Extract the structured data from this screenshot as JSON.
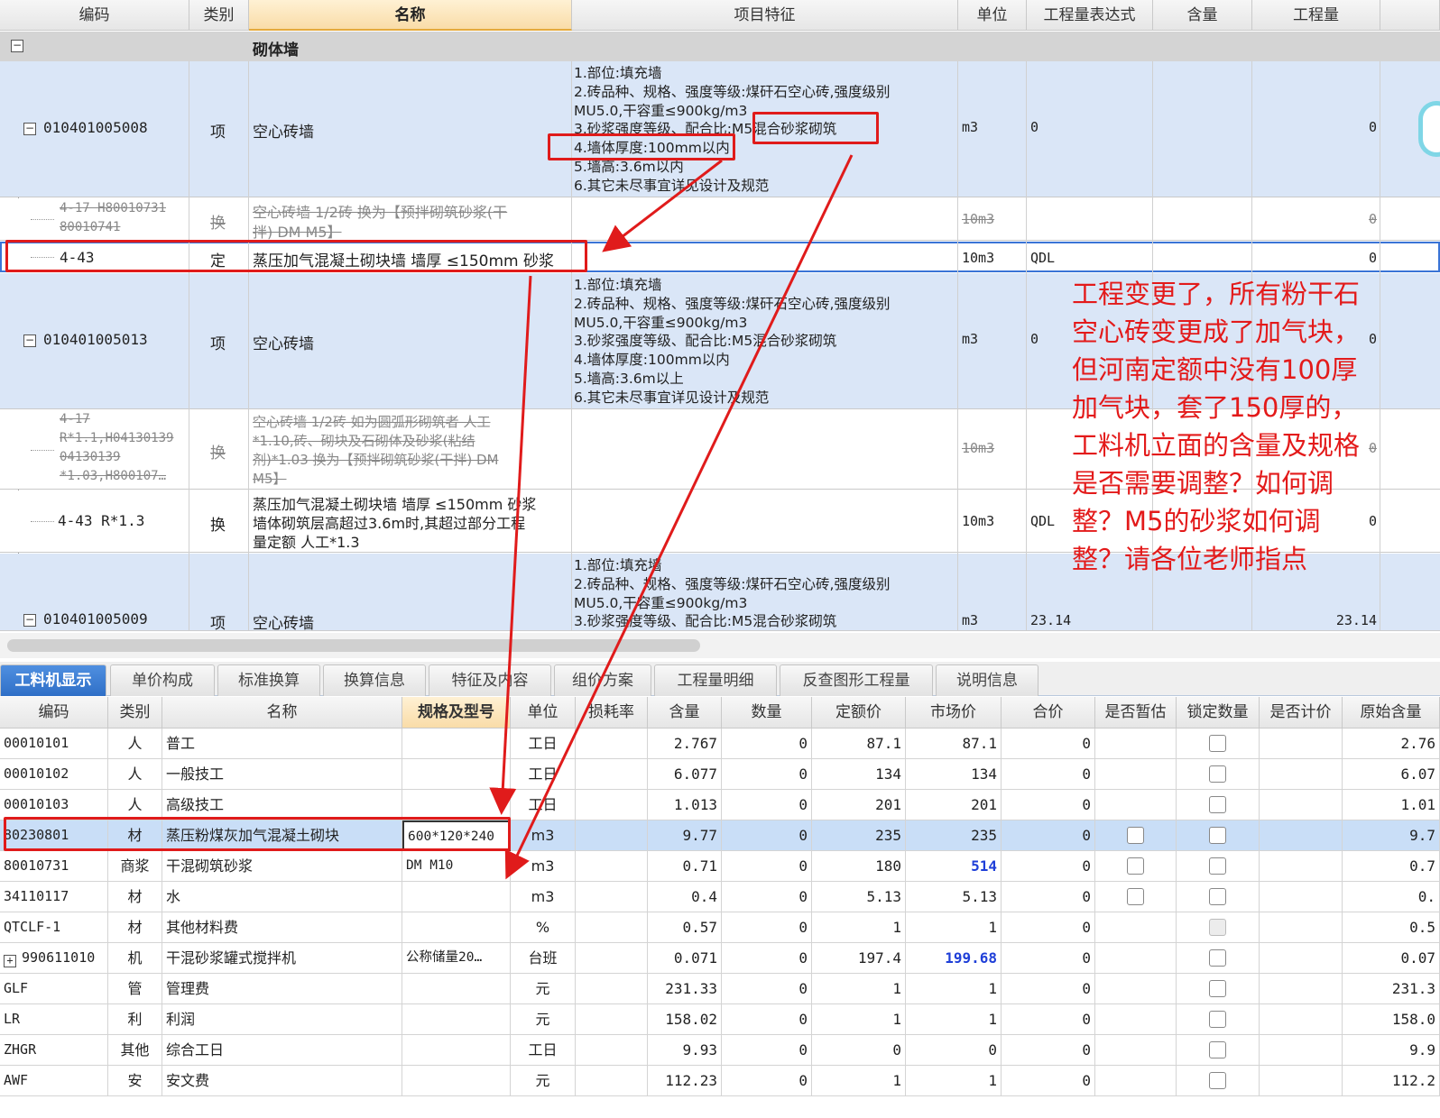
{
  "top_table": {
    "headers": [
      "编码",
      "类别",
      "名称",
      "项目特征",
      "单位",
      "工程量表达式",
      "含量",
      "工程量"
    ],
    "group": {
      "toggle": "−",
      "name": "砌体墙"
    },
    "rows": [
      {
        "code": "010401005008",
        "type": "项",
        "name": "空心砖墙",
        "features": [
          "1.部位:填充墙",
          "2.砖品种、规格、强度等级:煤矸石空心砖,强度级别",
          "MU5.0,干容重≤900kg/m3",
          "3.砂浆强度等级、配合比:M5混合砂浆砌筑",
          "4.墙体厚度:100mm以内",
          "5.墙高:3.6m以内",
          "6.其它未尽事宜详见设计及规范"
        ],
        "unit": "m3",
        "expr": "0",
        "qty": "0"
      },
      {
        "code_lines": [
          "4-17 H80010731",
          "80010741"
        ],
        "type": "换",
        "name_lines": [
          "空心砖墙 1/2砖  换为【预拌砌筑砂浆(干",
          "拌) DM M5】"
        ],
        "unit": "10m3",
        "qty": "0"
      },
      {
        "code": "4-43",
        "type": "定",
        "name": "蒸压加气混凝土砌块墙 墙厚 ≤150mm 砂浆",
        "unit": "10m3",
        "expr": "QDL",
        "qty": "0"
      },
      {
        "code": "010401005013",
        "type": "项",
        "name": "空心砖墙",
        "features": [
          "1.部位:填充墙",
          "2.砖品种、规格、强度等级:煤矸石空心砖,强度级别",
          "MU5.0,干容重≤900kg/m3",
          "3.砂浆强度等级、配合比:M5混合砂浆砌筑",
          "4.墙体厚度:100mm以内",
          "5.墙高:3.6m以上",
          "6.其它未尽事宜详见设计及规范"
        ],
        "unit": "m3",
        "expr": "0",
        "qty": "0"
      },
      {
        "code_lines": [
          "4-17",
          "R*1.1,H04130139",
          "04130139",
          "*1.03,H800107…"
        ],
        "type": "换",
        "name_lines": [
          "空心砖墙 1/2砖  如为圆弧形砌筑者 人工",
          "*1.10,砖、砌块及石砌体及砂浆(粘结",
          "剂)*1.03  换为【预拌砌筑砂浆(干拌) DM",
          "M5】"
        ],
        "unit": "10m3",
        "qty": "0"
      },
      {
        "code": "4-43 R*1.3",
        "type": "换",
        "name_lines": [
          "蒸压加气混凝土砌块墙 墙厚 ≤150mm 砂浆",
          " 墙体砌筑层高超过3.6m时,其超过部分工程",
          "量定额 人工*1.3"
        ],
        "unit": "10m3",
        "expr": "QDL",
        "qty": "0"
      },
      {
        "code": "010401005009",
        "type": "项",
        "name": "空心砖墙",
        "features": [
          "1.部位:填充墙",
          "2.砖品种、规格、强度等级:煤矸石空心砖,强度级别",
          "MU5.0,干容重≤900kg/m3",
          "3.砂浆强度等级、配合比:M5混合砂浆砌筑"
        ],
        "unit": "m3",
        "expr": "23.14",
        "qty": "23.14"
      }
    ]
  },
  "annotation": {
    "text": "工程变更了，所有粉干石空心砖变更成了加气块，但河南定额中没有100厚加气块，套了150厚的，工料机立面的含量及规格是否需要调整？如何调整？M5的砂浆如何调整？请各位老师指点",
    "color": "#e31a1a"
  },
  "tabs": [
    "工料机显示",
    "单价构成",
    "标准换算",
    "换算信息",
    "特征及内容",
    "组价方案",
    "工程量明细",
    "反查图形工程量",
    "说明信息"
  ],
  "bottom_table": {
    "headers": [
      "编码",
      "类别",
      "名称",
      "规格及型号",
      "单位",
      "损耗率",
      "含量",
      "数量",
      "定额价",
      "市场价",
      "合价",
      "是否暂估",
      "锁定数量",
      "是否计价",
      "原始含量"
    ],
    "rows": [
      {
        "code": "00010101",
        "type": "人",
        "name": "普工",
        "spec": "",
        "unit": "工日",
        "content": "2.767",
        "count": "0",
        "price": "87.1",
        "market": "87.1",
        "total": "0",
        "orig": "2.76"
      },
      {
        "code": "00010102",
        "type": "人",
        "name": "一般技工",
        "spec": "",
        "unit": "工日",
        "content": "6.077",
        "count": "0",
        "price": "134",
        "market": "134",
        "total": "0",
        "orig": "6.07"
      },
      {
        "code": "00010103",
        "type": "人",
        "name": "高级技工",
        "spec": "",
        "unit": "工日",
        "content": "1.013",
        "count": "0",
        "price": "201",
        "market": "201",
        "total": "0",
        "orig": "1.01"
      },
      {
        "code": "80230801",
        "type": "材",
        "name": "蒸压粉煤灰加气混凝土砌块",
        "spec": "600*120*240",
        "unit": "m3",
        "content": "9.77",
        "count": "0",
        "price": "235",
        "market": "235",
        "total": "0",
        "orig": "9.7"
      },
      {
        "code": "80010731",
        "type": "商浆",
        "name": "干混砌筑砂浆",
        "spec": "DM M10",
        "unit": "m3",
        "content": "0.71",
        "count": "0",
        "price": "180",
        "market": "514",
        "total": "0",
        "orig": "0.7"
      },
      {
        "code": "34110117",
        "type": "材",
        "name": "水",
        "spec": "",
        "unit": "m3",
        "content": "0.4",
        "count": "0",
        "price": "5.13",
        "market": "5.13",
        "total": "0",
        "orig": "0."
      },
      {
        "code": "QTCLF-1",
        "type": "材",
        "name": "其他材料费",
        "spec": "",
        "unit": "%",
        "content": "0.57",
        "count": "0",
        "price": "1",
        "market": "1",
        "total": "0",
        "orig": "0.5"
      },
      {
        "code": "990611010",
        "type": "机",
        "name": "干混砂浆罐式搅拌机",
        "spec": "公称储量20…",
        "unit": "台班",
        "content": "0.071",
        "count": "0",
        "price": "197.4",
        "market": "199.68",
        "total": "0",
        "orig": "0.07"
      },
      {
        "code": "GLF",
        "type": "管",
        "name": "管理费",
        "spec": "",
        "unit": "元",
        "content": "231.33",
        "count": "0",
        "price": "1",
        "market": "1",
        "total": "0",
        "orig": "231.3"
      },
      {
        "code": "LR",
        "type": "利",
        "name": "利润",
        "spec": "",
        "unit": "元",
        "content": "158.02",
        "count": "0",
        "price": "1",
        "market": "1",
        "total": "0",
        "orig": "158.0"
      },
      {
        "code": "ZHGR",
        "type": "其他",
        "name": "综合工日",
        "spec": "",
        "unit": "工日",
        "content": "9.93",
        "count": "0",
        "price": "0",
        "market": "0",
        "total": "0",
        "orig": "9.9"
      },
      {
        "code": "AWF",
        "type": "安",
        "name": "安文费",
        "spec": "",
        "unit": "元",
        "content": "112.23",
        "count": "0",
        "price": "1",
        "market": "1",
        "total": "0",
        "orig": "112.2"
      }
    ]
  }
}
